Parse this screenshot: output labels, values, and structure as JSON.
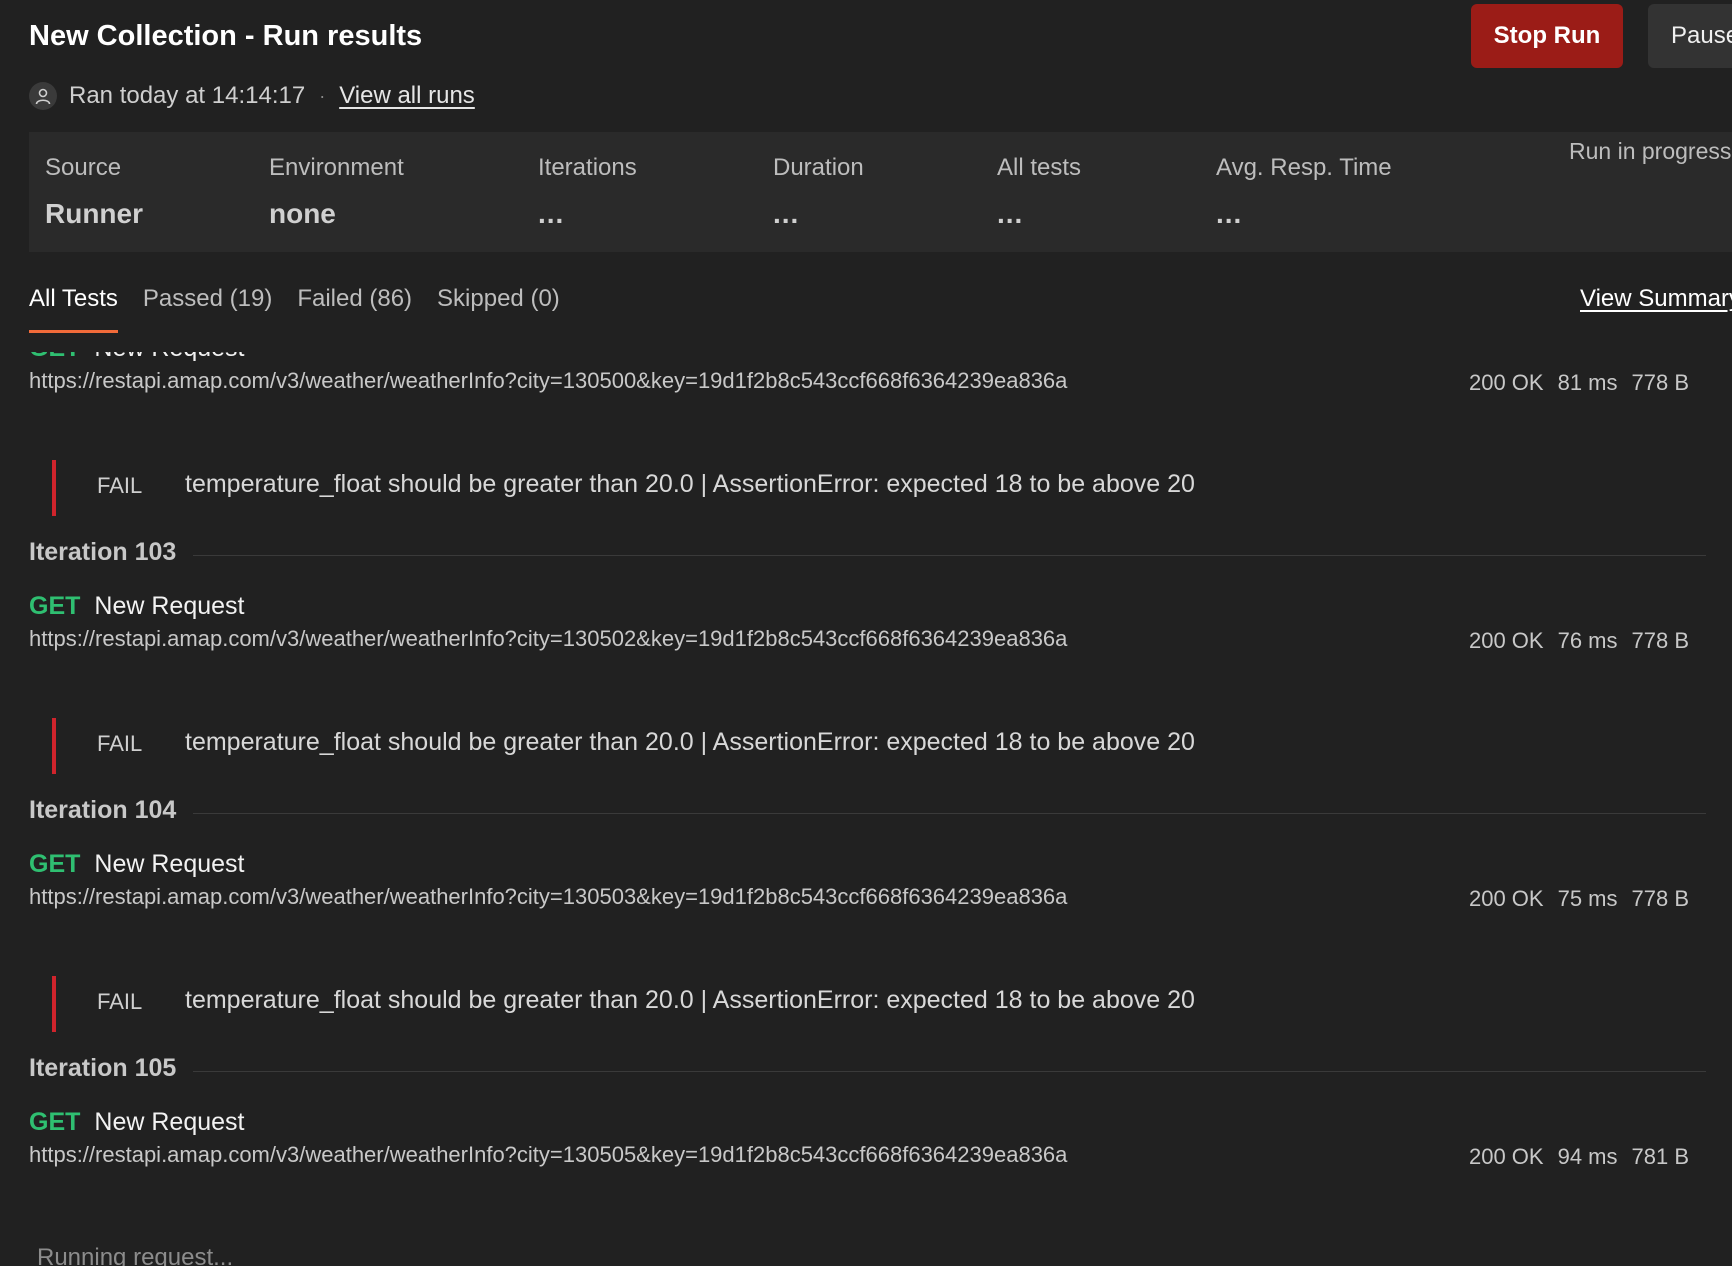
{
  "header": {
    "title": "New Collection - Run results",
    "stop_label": "Stop Run",
    "pause_label": "Pause"
  },
  "meta": {
    "ran_text": "Ran today at 14:14:17",
    "separator": "·",
    "view_all_runs": "View all runs"
  },
  "stats": {
    "source_label": "Source",
    "source_value": "Runner",
    "environment_label": "Environment",
    "environment_value": "none",
    "iterations_label": "Iterations",
    "iterations_value": "...",
    "duration_label": "Duration",
    "duration_value": "...",
    "all_tests_label": "All tests",
    "all_tests_value": "...",
    "avg_resp_label": "Avg. Resp. Time",
    "avg_resp_value": "...",
    "status": "Run in progress"
  },
  "tabs": {
    "all": "All Tests",
    "passed": "Passed (19)",
    "failed": "Failed (86)",
    "skipped": "Skipped (0)",
    "view_summary": "View Summary"
  },
  "results": {
    "first": {
      "method": "GET",
      "name": "New Request",
      "url": "https://restapi.amap.com/v3/weather/weatherInfo?city=130500&key=19d1f2b8c543ccf668f6364239ea836a",
      "status": "200 OK",
      "time": "81 ms",
      "size": "778 B",
      "fail_label": "FAIL",
      "fail_message": "temperature_float should be greater than 20.0 | AssertionError: expected 18 to be above 20"
    },
    "iter103": {
      "label": "Iteration 103",
      "method": "GET",
      "name": "New Request",
      "url": "https://restapi.amap.com/v3/weather/weatherInfo?city=130502&key=19d1f2b8c543ccf668f6364239ea836a",
      "status": "200 OK",
      "time": "76 ms",
      "size": "778 B",
      "fail_label": "FAIL",
      "fail_message": "temperature_float should be greater than 20.0 | AssertionError: expected 18 to be above 20"
    },
    "iter104": {
      "label": "Iteration 104",
      "method": "GET",
      "name": "New Request",
      "url": "https://restapi.amap.com/v3/weather/weatherInfo?city=130503&key=19d1f2b8c543ccf668f6364239ea836a",
      "status": "200 OK",
      "time": "75 ms",
      "size": "778 B",
      "fail_label": "FAIL",
      "fail_message": "temperature_float should be greater than 20.0 | AssertionError: expected 18 to be above 20"
    },
    "iter105": {
      "label": "Iteration 105",
      "method": "GET",
      "name": "New Request",
      "url": "https://restapi.amap.com/v3/weather/weatherInfo?city=130505&key=19d1f2b8c543ccf668f6364239ea836a",
      "status": "200 OK",
      "time": "94 ms",
      "size": "781 B"
    },
    "running_text": "Running request..."
  }
}
